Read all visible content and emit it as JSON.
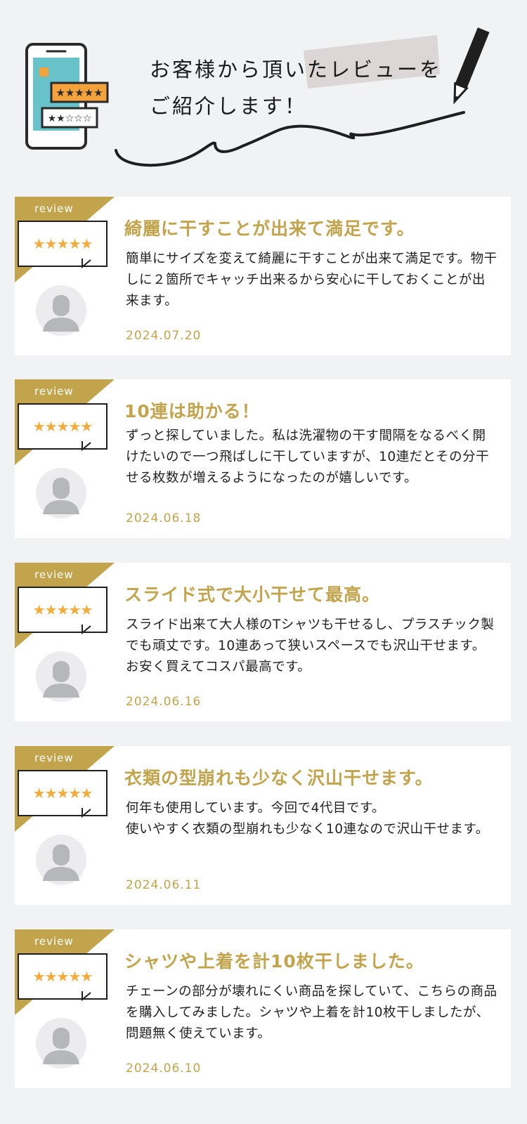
{
  "header": {
    "line1": "お客様から頂いたレビューを",
    "line2": "ご紹介します！"
  },
  "colors": {
    "background": "#f1f2f4",
    "accent_gold": "#c2a44c",
    "star_orange": "#f4ab3a",
    "avatar_gray": "#b5b7bb"
  },
  "reviews": [
    {
      "label": "review",
      "rating": 5,
      "stars": "★★★★★",
      "title": "綺麗に干すことが出来て満足です。",
      "body": "簡単にサイズを変えて綺麗に干すことが出来て満足です。物干しに２箇所でキャッチ出来るから安心に干しておくことが出来ます。",
      "date": "2024.07.20"
    },
    {
      "label": "review",
      "rating": 5,
      "stars": "★★★★★",
      "title": "10連は助かる！",
      "body": "ずっと探していました。私は洗濯物の干す間隔をなるべく開けたいので一つ飛ばしに干していますが、10連だとその分干せる枚数が増えるようになったのが嬉しいです。",
      "date": "2024.06.18"
    },
    {
      "label": "review",
      "rating": 5,
      "stars": "★★★★★",
      "title": "スライド式で大小干せて最高。",
      "body": "スライド出来て大人様のTシャツも干せるし、プラスチック製でも頑丈です。10連あって狭いスペースでも沢山干せます。お安く買えてコスパ最高です。",
      "date": "2024.06.16"
    },
    {
      "label": "review",
      "rating": 5,
      "stars": "★★★★★",
      "title": "衣類の型崩れも少なく沢山干せます。",
      "body": "何年も使用しています。今回で4代目です。\n使いやすく衣類の型崩れも少なく10連なので沢山干せます。",
      "date": "2024.06.11"
    },
    {
      "label": "review",
      "rating": 5,
      "stars": "★★★★★",
      "title": "シャツや上着を計10枚干しました。",
      "body": "チェーンの部分が壊れにくい商品を探していて、こちらの商品を購入してみました。シャツや上着を計10枚干しましたが、問題無く使えています。",
      "date": "2024.06.10"
    }
  ]
}
